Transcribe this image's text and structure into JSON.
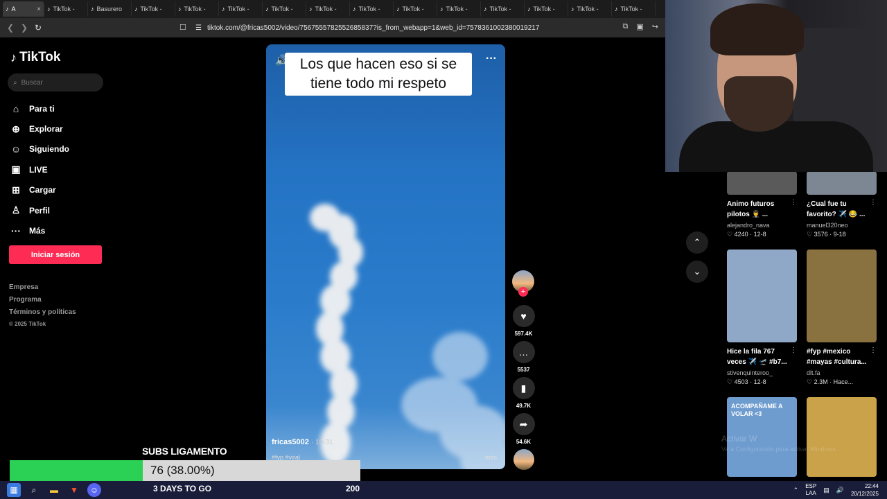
{
  "browser": {
    "tabs": [
      {
        "label": "A",
        "active": true
      },
      {
        "label": "TikTok -"
      },
      {
        "label": "Basurero"
      },
      {
        "label": "TikTok -"
      },
      {
        "label": "TikTok -"
      },
      {
        "label": "TikTok -"
      },
      {
        "label": "TikTok -"
      },
      {
        "label": "TikTok -"
      },
      {
        "label": "TikTok -"
      },
      {
        "label": "TikTok -"
      },
      {
        "label": "TikTok -"
      },
      {
        "label": "TikTok -"
      },
      {
        "label": "TikTok -"
      },
      {
        "label": "TikTok -"
      },
      {
        "label": "TikTok -"
      }
    ],
    "url": "tiktok.com/@fricas5002/video/7567555782552685837?is_from_webapp=1&web_id=7578361002380019217"
  },
  "sidebar": {
    "brand": "TikTok",
    "search_placeholder": "Buscar",
    "items": [
      {
        "label": "Para ti",
        "icon": "home-icon"
      },
      {
        "label": "Explorar",
        "icon": "compass-icon"
      },
      {
        "label": "Siguiendo",
        "icon": "following-icon"
      },
      {
        "label": "LIVE",
        "icon": "live-icon"
      },
      {
        "label": "Cargar",
        "icon": "upload-icon"
      },
      {
        "label": "Perfil",
        "icon": "profile-icon"
      },
      {
        "label": "Más",
        "icon": "more-icon"
      }
    ],
    "login": "Iniciar sesión",
    "footer": [
      "Empresa",
      "Programa",
      "Términos y políticas"
    ],
    "copyright": "© 2025 TikTok"
  },
  "video": {
    "caption": "Los que hacen eso si se tiene todo mi respeto",
    "author": "fricas5002",
    "date": "· 10-31",
    "tags": "#fyp #viral",
    "more": "más"
  },
  "actions": {
    "likes": "597.4K",
    "comments": "5537",
    "saves": "49.7K",
    "shares": "54.6K"
  },
  "feed": [
    {
      "title": "Animo futuros pilotos 👨‍✈️ ...",
      "user": "alejandro_nava",
      "likes": "4240",
      "date": "· 12-8",
      "thumb": "#5a5a5a"
    },
    {
      "title": "¿Cual fue tu favorito? ✈️ 😂 ...",
      "user": "manuel320neo",
      "likes": "3576",
      "date": "· 9-18",
      "thumb": "#7d8794"
    },
    {
      "title": "Hice la fila 767 veces ✈️ 🛫 #b7...",
      "user": "stivenquinteroo_",
      "likes": "4503",
      "date": "· 12-8",
      "thumb": "#8fa8c7"
    },
    {
      "title": "#fyp #mexico #mayas #cultura...",
      "user": "dlt.fa",
      "likes": "2.3M",
      "date": "· Hace...",
      "thumb": "#8a7140"
    },
    {
      "title": "ACOMPAÑAME A VOLAR <3",
      "user": "",
      "likes": "",
      "date": "",
      "thumb": "#6f9ccf"
    },
    {
      "title": "",
      "user": "",
      "likes": "",
      "date": "",
      "thumb": "#c9a24a"
    }
  ],
  "overlay": {
    "goal_label": "SUBS LIGAMENTO",
    "progress_text": "76 (38.00%)",
    "progress_fraction": 0.38,
    "days": "3 DAYS TO GO",
    "goal": "200",
    "watermark": "Activar W",
    "watermark_sub": "Ve a Configuración para activar Windows."
  },
  "taskbar": {
    "lang_top": "ESP",
    "lang_bottom": "LAA",
    "time": "22:44",
    "date": "20/12/2025"
  }
}
